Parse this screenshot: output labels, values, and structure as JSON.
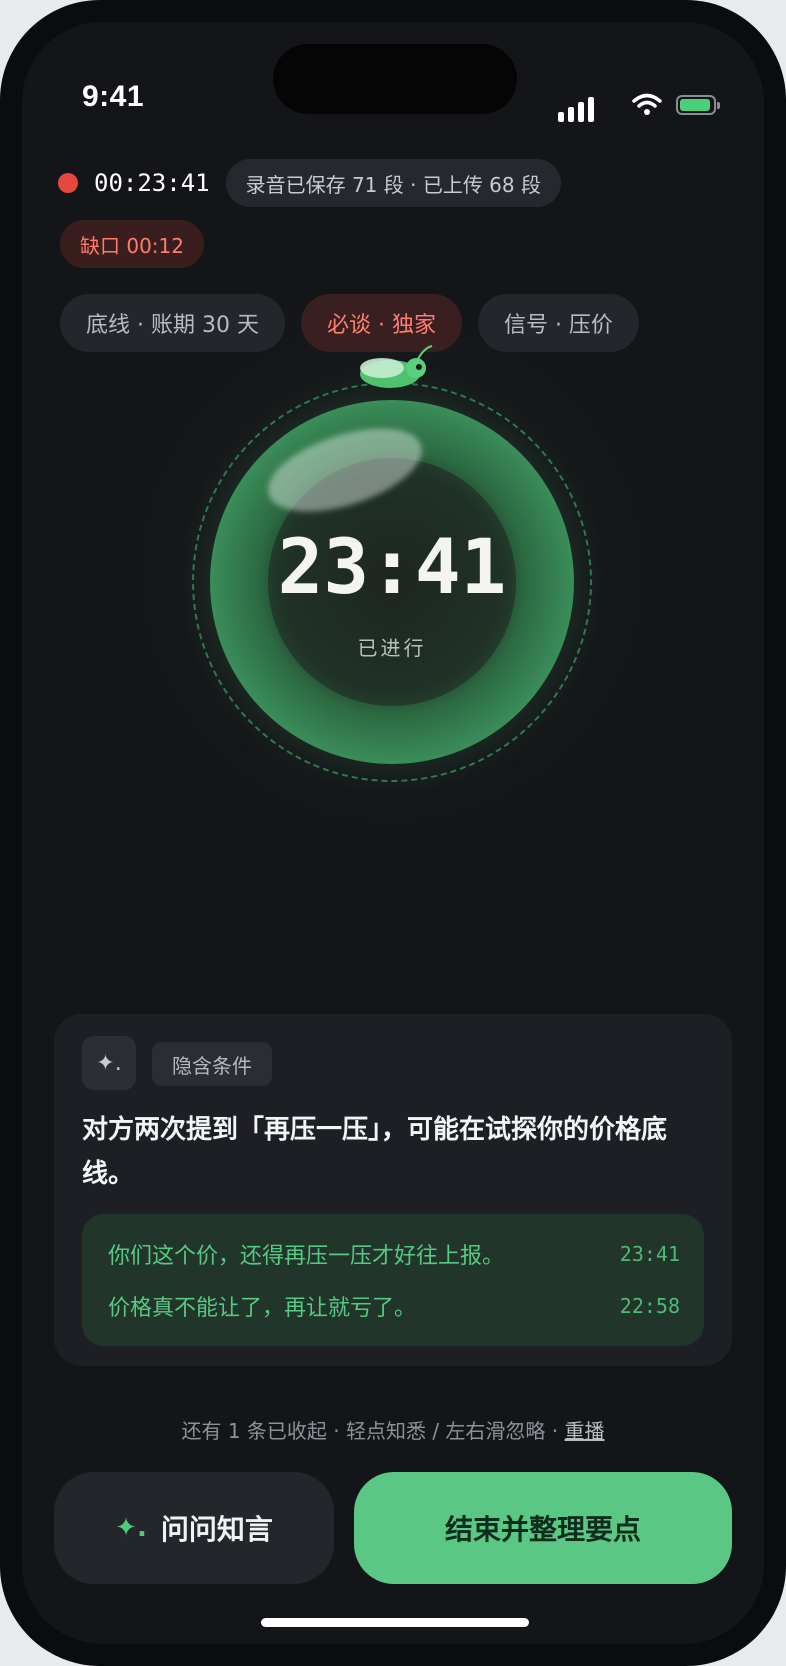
{
  "status_bar": {
    "time": "9:41"
  },
  "recording": {
    "elapsed": "00:23:41",
    "status": "录音已保存 71 段 · 已上传 68 段",
    "gap_badge": "缺口 00:12"
  },
  "chips": [
    {
      "label": "底线 · 账期 30 天"
    },
    {
      "label": "必谈 · 独家"
    },
    {
      "label": "信号 · 压价"
    }
  ],
  "orb": {
    "time": "23:41",
    "label": "已进行"
  },
  "insight_card": {
    "spark_icon": "✦.",
    "tag": "隐含条件",
    "text": "对方两次提到「再压一压」，可能在试探你的价格底线。",
    "quotes": [
      {
        "text": "你们这个价，还得再压一压才好往上报。",
        "time": "23:41"
      },
      {
        "text": "价格真不能让了，再让就亏了。",
        "time": "22:58"
      }
    ]
  },
  "hint": {
    "text": "还有 1 条已收起 · 轻点知悉 / 左右滑忽略 · ",
    "replay": "重播"
  },
  "actions": {
    "ask_icon": "✦.",
    "ask_label": "问问知言",
    "end_label": "结束并整理要点"
  },
  "colors": {
    "accent_green": "#5bc785",
    "record_red": "#e5483b",
    "warning_red": "#ff7b6e",
    "background": "#141518"
  }
}
